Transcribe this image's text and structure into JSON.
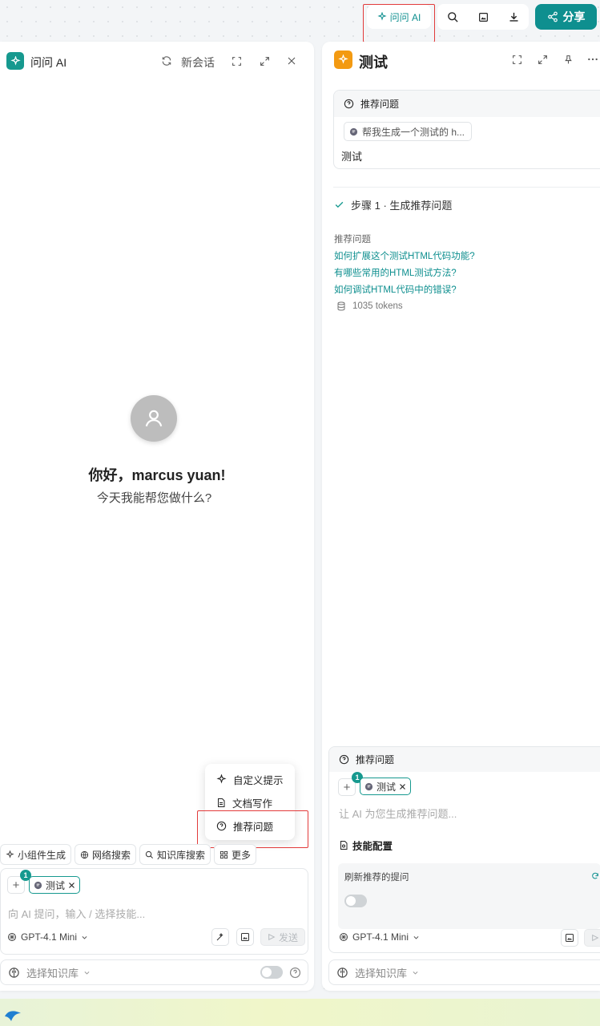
{
  "top_bar": {
    "ask_ai_label": "问问 AI",
    "share_label": "分享"
  },
  "left_panel": {
    "title": "问问 AI",
    "new_chat_label": "新会话",
    "greeting": "你好，marcus yuan!",
    "greeting_sub": "今天我能帮您做什么?",
    "menu": {
      "items": [
        {
          "label": "自定义提示",
          "icon": "sparkle-icon"
        },
        {
          "label": "文档写作",
          "icon": "document-icon"
        },
        {
          "label": "推荐问题",
          "icon": "help-circle-icon"
        }
      ]
    },
    "chips": [
      {
        "label": "小组件生成",
        "icon": "sparkle-icon"
      },
      {
        "label": "网络搜索",
        "icon": "globe-icon"
      },
      {
        "label": "知识库搜索",
        "icon": "search-icon"
      },
      {
        "label": "更多",
        "icon": "grid-icon"
      }
    ],
    "input": {
      "context_badge": "1",
      "context_chip": "测试",
      "placeholder": "向 AI 提问，输入 / 选择技能...",
      "model": "GPT-4.1 Mini",
      "send_label": "发送"
    },
    "knowledge_base_label": "选择知识库"
  },
  "right_panel": {
    "title": "测试",
    "question_card": {
      "header": "推荐问题",
      "pill_text": "帮我生成一个测试的 h...",
      "body_text": "测试"
    },
    "step_label": "步骤 1 · 生成推荐问题",
    "recommended_label": "推荐问题",
    "recommended_questions": [
      "如何扩展这个测试HTML代码功能?",
      "有哪些常用的HTML测试方法?",
      "如何调试HTML代码中的错误?"
    ],
    "tokens": "1035 tokens",
    "skill_card": {
      "header": "推荐问题",
      "context_badge": "1",
      "context_chip": "测试",
      "placeholder": "让 AI 为您生成推荐问题...",
      "skill_config_label": "技能配置",
      "refresh_label": "刷新推荐的提问",
      "model": "GPT-4.1 Mini"
    },
    "knowledge_base_label": "选择知识库"
  },
  "colors": {
    "accent": "#0e8f8f",
    "highlight": "#e23b3b",
    "right_logo": "#f39a12"
  }
}
